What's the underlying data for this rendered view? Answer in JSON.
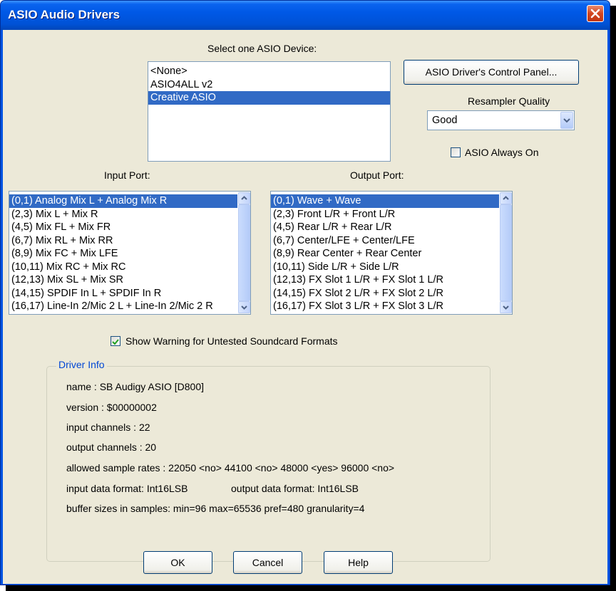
{
  "window": {
    "title": "ASIO Audio Drivers"
  },
  "device": {
    "label": "Select one ASIO Device:",
    "items": [
      "<None>",
      "ASIO4ALL v2",
      "Creative ASIO"
    ],
    "selected_index": 2
  },
  "control_panel_button": "ASIO Driver's Control Panel...",
  "resampler": {
    "label": "Resampler Quality",
    "value": "Good"
  },
  "always_on": {
    "label": "ASIO Always On",
    "checked": false
  },
  "input_port": {
    "label": "Input Port:",
    "items": [
      "(0,1) Analog Mix L + Analog Mix R",
      "(2,3) Mix L + Mix R",
      "(4,5) Mix FL + Mix FR",
      "(6,7) Mix RL + Mix RR",
      "(8,9) Mix FC + Mix LFE",
      "(10,11) Mix RC + Mix RC",
      "(12,13) Mix SL + Mix SR",
      "(14,15) SPDIF In L + SPDIF In R",
      "(16,17) Line-In 2/Mic 2 L + Line-In 2/Mic 2 R"
    ],
    "selected_index": 0
  },
  "output_port": {
    "label": "Output Port:",
    "items": [
      "(0,1) Wave + Wave",
      "(2,3) Front L/R + Front L/R",
      "(4,5) Rear L/R + Rear L/R",
      "(6,7) Center/LFE + Center/LFE",
      "(8,9) Rear Center + Rear Center",
      "(10,11) Side L/R + Side L/R",
      "(12,13) FX Slot 1 L/R + FX Slot 1 L/R",
      "(14,15) FX Slot 2 L/R + FX Slot 2 L/R",
      "(16,17) FX Slot 3 L/R + FX Slot 3 L/R"
    ],
    "selected_index": 0
  },
  "show_warning": {
    "label": "Show Warning for Untested Soundcard Formats",
    "checked": true
  },
  "driver_info": {
    "title": "Driver Info",
    "name": "name : SB Audigy ASIO [D800]",
    "version": "version : $00000002",
    "input_channels": "input channels : 22",
    "output_channels": "output channels : 20",
    "sample_rates": "allowed sample rates : 22050 <no> 44100 <no> 48000 <yes> 96000 <no>",
    "input_format": "input data format: Int16LSB",
    "output_format": "output data format: Int16LSB",
    "buffer_sizes": "buffer sizes in samples: min=96 max=65536 pref=480 granularity=4"
  },
  "buttons": {
    "ok": "OK",
    "cancel": "Cancel",
    "help": "Help"
  },
  "colors": {
    "title_bar": "#0058e6",
    "selection": "#316ac5",
    "face": "#ece9d8",
    "group_title": "#0046d5"
  }
}
